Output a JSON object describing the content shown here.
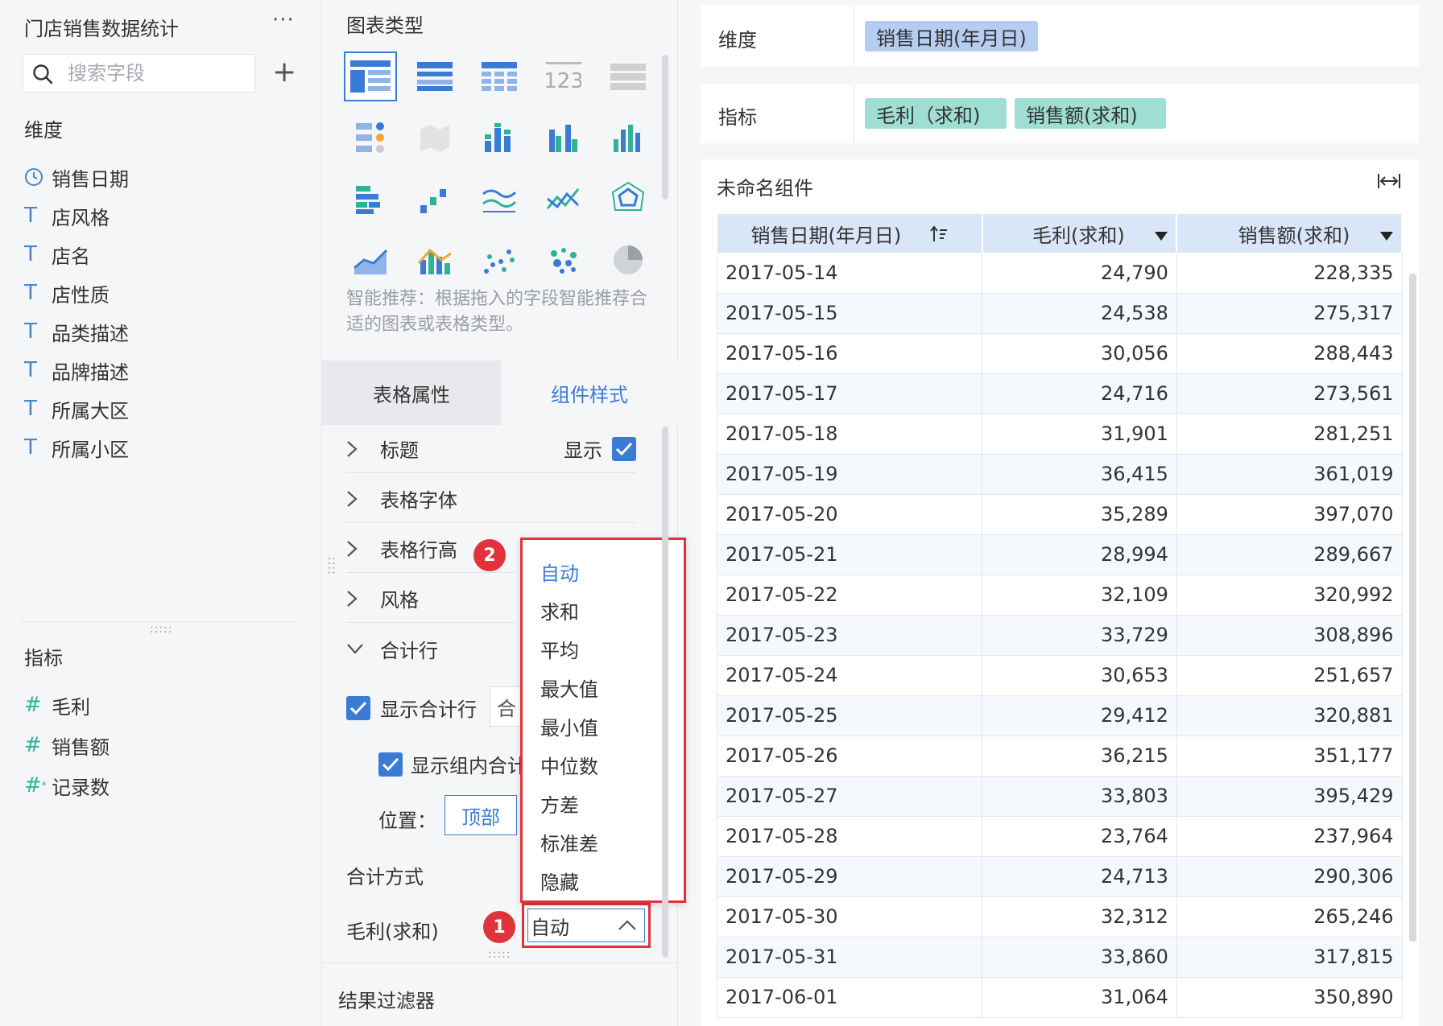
{
  "fields_panel": {
    "dataset_title": "门店销售数据统计",
    "more": "···",
    "search_placeholder": "搜索字段",
    "add": "+",
    "dimensions_label": "维度",
    "dimensions": [
      {
        "icon": "clock-icon",
        "label": "销售日期"
      },
      {
        "icon": "text-type-icon",
        "label": "店风格"
      },
      {
        "icon": "text-type-icon",
        "label": "店名"
      },
      {
        "icon": "text-type-icon",
        "label": "店性质"
      },
      {
        "icon": "text-type-icon",
        "label": "品类描述"
      },
      {
        "icon": "text-type-icon",
        "label": "品牌描述"
      },
      {
        "icon": "text-type-icon",
        "label": "所属大区"
      },
      {
        "icon": "text-type-icon",
        "label": "所属小区"
      }
    ],
    "metrics_label": "指标",
    "metrics": [
      {
        "icon": "number-type-icon",
        "label": "毛利"
      },
      {
        "icon": "number-type-icon",
        "label": "销售额"
      },
      {
        "icon": "record-count-icon",
        "label": "记录数"
      }
    ]
  },
  "chart_panel": {
    "title": "图表类型",
    "smart_tip": "智能推荐：根据拖入的字段智能推荐合适的图表或表格类型。",
    "tabs": [
      "表格属性",
      "组件样式"
    ],
    "active_tab": "组件样式",
    "sections": [
      {
        "label": "标题",
        "expanded": false,
        "right_label": "显示",
        "checked": true
      },
      {
        "label": "表格字体",
        "expanded": false
      },
      {
        "label": "表格行高",
        "expanded": false
      },
      {
        "label": "风格",
        "expanded": false
      },
      {
        "label": "合计行",
        "expanded": true
      }
    ],
    "show_total_row": "显示合计行",
    "total_select_partial": "合",
    "show_group_total": "显示组内合计",
    "position_label": "位置：",
    "position_value": "顶部",
    "total_method_label": "合计方式",
    "metric_row_label": "毛利(求和)",
    "agg_value": "自动",
    "agg_options": [
      "自动",
      "求和",
      "平均",
      "最大值",
      "最小值",
      "中位数",
      "方差",
      "标准差",
      "隐藏"
    ],
    "selected_option": "自动",
    "badge_1": "1",
    "badge_2": "2",
    "result_filter": "结果过滤器",
    "accent_color": "#3a7bd5",
    "highlight_color": "#e0333c"
  },
  "editor": {
    "dimension_bar_label": "维度",
    "dimension_pill": "销售日期(年月日)",
    "metric_bar_label": "指标",
    "metric_pills": [
      "毛利（求和)",
      "销售额(求和)"
    ],
    "widget_title": "未命名组件",
    "table": {
      "headers": [
        "销售日期(年月日)",
        "毛利(求和)",
        "销售额(求和)"
      ],
      "rows": [
        [
          "2017-05-14",
          "24,790",
          "228,335"
        ],
        [
          "2017-05-15",
          "24,538",
          "275,317"
        ],
        [
          "2017-05-16",
          "30,056",
          "288,443"
        ],
        [
          "2017-05-17",
          "24,716",
          "273,561"
        ],
        [
          "2017-05-18",
          "31,901",
          "281,251"
        ],
        [
          "2017-05-19",
          "36,415",
          "361,019"
        ],
        [
          "2017-05-20",
          "35,289",
          "397,070"
        ],
        [
          "2017-05-21",
          "28,994",
          "289,667"
        ],
        [
          "2017-05-22",
          "32,109",
          "320,992"
        ],
        [
          "2017-05-23",
          "33,729",
          "308,896"
        ],
        [
          "2017-05-24",
          "30,653",
          "251,657"
        ],
        [
          "2017-05-25",
          "29,412",
          "320,881"
        ],
        [
          "2017-05-26",
          "36,215",
          "351,177"
        ],
        [
          "2017-05-27",
          "33,803",
          "395,429"
        ],
        [
          "2017-05-28",
          "23,764",
          "237,964"
        ],
        [
          "2017-05-29",
          "24,713",
          "290,306"
        ],
        [
          "2017-05-30",
          "32,312",
          "265,246"
        ],
        [
          "2017-05-31",
          "33,860",
          "317,815"
        ],
        [
          "2017-06-01",
          "31,064",
          "350,890"
        ]
      ]
    }
  }
}
